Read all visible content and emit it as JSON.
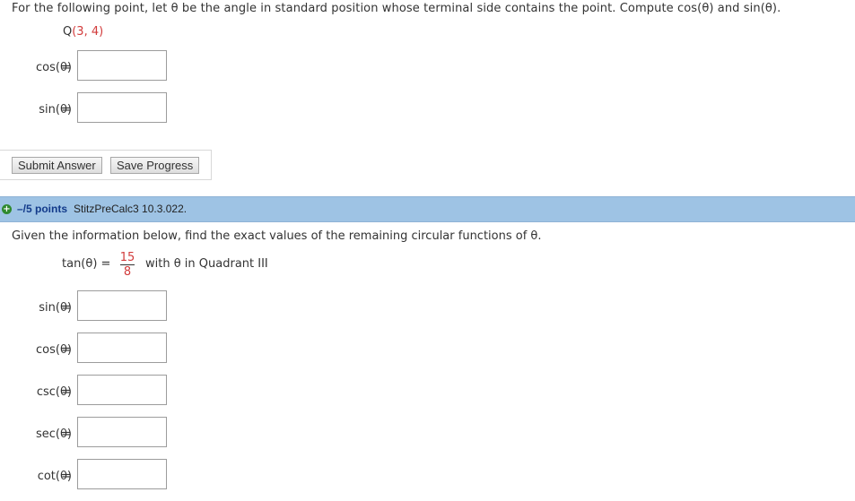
{
  "q1": {
    "prompt": "For the following point, let θ be the angle in standard position whose terminal side contains the point. Compute cos(θ) and sin(θ).",
    "point_label": "Q",
    "point_value": "(3, 4)",
    "rows": [
      {
        "label": "cos(θ)",
        "eq": "=",
        "value": ""
      },
      {
        "label": "sin(θ)",
        "eq": "=",
        "value": ""
      }
    ]
  },
  "buttons": {
    "submit": "Submit Answer",
    "save": "Save Progress"
  },
  "q2_header": {
    "points": "–/5 points",
    "reference": "StitzPreCalc3 10.3.022."
  },
  "q2": {
    "prompt": "Given the information below, find the exact values of the remaining circular functions of θ.",
    "tan_label": "tan(θ)",
    "tan_eq": "=",
    "frac_num": "15",
    "frac_den": "8",
    "quadrant_text": "with θ in Quadrant III",
    "rows": [
      {
        "label": "sin(θ)",
        "eq": "=",
        "value": ""
      },
      {
        "label": "cos(θ)",
        "eq": "=",
        "value": ""
      },
      {
        "label": "csc(θ)",
        "eq": "=",
        "value": ""
      },
      {
        "label": "sec(θ)",
        "eq": "=",
        "value": ""
      },
      {
        "label": "cot(θ)",
        "eq": "=",
        "value": ""
      }
    ]
  },
  "colors": {
    "header_bar": "#9ec3e4",
    "points_link": "#123a8a",
    "math_value": "#d23c3c"
  },
  "icons": {
    "expand": "plus-circle-icon"
  }
}
